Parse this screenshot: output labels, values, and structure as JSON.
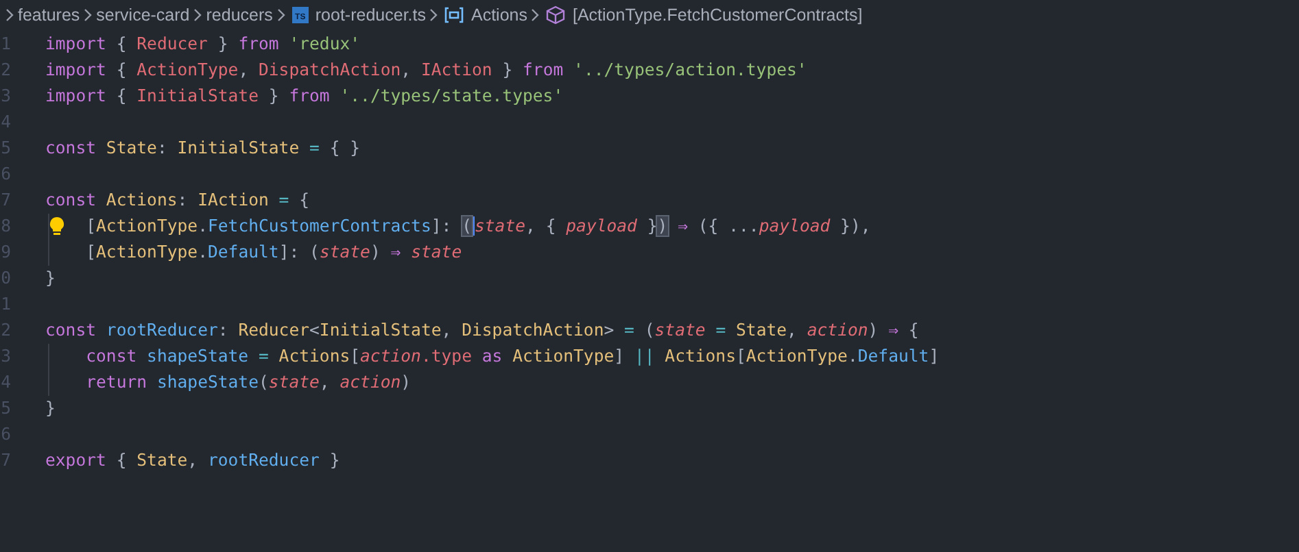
{
  "breadcrumb": [
    {
      "kind": "folder",
      "label": "features"
    },
    {
      "kind": "folder",
      "label": "service-card"
    },
    {
      "kind": "folder",
      "label": "reducers"
    },
    {
      "kind": "ts-file",
      "label": "root-reducer.ts",
      "badge": "TS"
    },
    {
      "kind": "variable",
      "label": "Actions"
    },
    {
      "kind": "member",
      "label": "[ActionType.FetchCustomerContracts]"
    }
  ],
  "lines": [
    {
      "number": "1",
      "tokens": [
        {
          "text": "import",
          "kind": "kw"
        },
        {
          "text": " { ",
          "kind": "p"
        },
        {
          "text": "Reducer",
          "kind": "var"
        },
        {
          "text": " } ",
          "kind": "p"
        },
        {
          "text": "from",
          "kind": "kw"
        },
        {
          "text": " 'redux'",
          "kind": "str"
        }
      ]
    },
    {
      "number": "2",
      "tokens": [
        {
          "text": "import",
          "kind": "kw"
        },
        {
          "text": " { ",
          "kind": "p"
        },
        {
          "text": "ActionType",
          "kind": "var"
        },
        {
          "text": ", ",
          "kind": "p"
        },
        {
          "text": "DispatchAction",
          "kind": "var"
        },
        {
          "text": ", ",
          "kind": "p"
        },
        {
          "text": "IAction",
          "kind": "var"
        },
        {
          "text": " } ",
          "kind": "p"
        },
        {
          "text": "from",
          "kind": "kw"
        },
        {
          "text": " '../types/action.types'",
          "kind": "str"
        }
      ]
    },
    {
      "number": "3",
      "tokens": [
        {
          "text": "import",
          "kind": "kw"
        },
        {
          "text": " { ",
          "kind": "p"
        },
        {
          "text": "InitialState",
          "kind": "var"
        },
        {
          "text": " } ",
          "kind": "p"
        },
        {
          "text": "from",
          "kind": "kw"
        },
        {
          "text": " '../types/state.types'",
          "kind": "str"
        }
      ]
    },
    {
      "number": "4"
    },
    {
      "number": "5",
      "tokens": [
        {
          "text": "const",
          "kind": "kw"
        },
        {
          "text": " State",
          "kind": "type"
        },
        {
          "text": ": ",
          "kind": "p"
        },
        {
          "text": "InitialState",
          "kind": "type"
        },
        {
          "text": " = ",
          "kind": "op"
        },
        {
          "text": "{ }",
          "kind": "p"
        }
      ]
    },
    {
      "number": "6"
    },
    {
      "number": "7",
      "tokens": [
        {
          "text": "const",
          "kind": "kw"
        },
        {
          "text": " Actions",
          "kind": "type"
        },
        {
          "text": ": ",
          "kind": "p"
        },
        {
          "text": "IAction",
          "kind": "type"
        },
        {
          "text": " = ",
          "kind": "op"
        },
        {
          "text": "{",
          "kind": "p"
        }
      ]
    },
    {
      "number": "8",
      "lightbulb": true,
      "tokens": [
        {
          "text": "    [",
          "kind": "p"
        },
        {
          "text": "ActionType",
          "kind": "type"
        },
        {
          "text": ".",
          "kind": "p"
        },
        {
          "text": "FetchCustomerContracts",
          "kind": "fn"
        },
        {
          "text": "]: ",
          "kind": "p"
        },
        {
          "text": "(",
          "kind": "bracket"
        },
        {
          "text": "state",
          "kind": "param",
          "cursor": true
        },
        {
          "text": ", { ",
          "kind": "p"
        },
        {
          "text": "payload",
          "kind": "param"
        },
        {
          "text": " }",
          "kind": "p"
        },
        {
          "text": ")",
          "kind": "bracket"
        },
        {
          "text": " ⇒ ",
          "kind": "kw"
        },
        {
          "text": "({ ...",
          "kind": "p"
        },
        {
          "text": "payload",
          "kind": "param"
        },
        {
          "text": " }),",
          "kind": "p"
        }
      ]
    },
    {
      "number": "9",
      "tokens": [
        {
          "text": "    [",
          "kind": "p"
        },
        {
          "text": "ActionType",
          "kind": "type"
        },
        {
          "text": ".",
          "kind": "p"
        },
        {
          "text": "Default",
          "kind": "fn"
        },
        {
          "text": "]: (",
          "kind": "p"
        },
        {
          "text": "state",
          "kind": "param"
        },
        {
          "text": ") ",
          "kind": "p"
        },
        {
          "text": "⇒",
          "kind": "kw"
        },
        {
          "text": " state",
          "kind": "param"
        }
      ]
    },
    {
      "number": "0",
      "tokens": [
        {
          "text": "}",
          "kind": "p"
        }
      ]
    },
    {
      "number": "1"
    },
    {
      "number": "2",
      "tokens": [
        {
          "text": "const",
          "kind": "kw"
        },
        {
          "text": " rootReducer",
          "kind": "fn"
        },
        {
          "text": ": ",
          "kind": "p"
        },
        {
          "text": "Reducer",
          "kind": "type"
        },
        {
          "text": "<",
          "kind": "p"
        },
        {
          "text": "InitialState",
          "kind": "type"
        },
        {
          "text": ", ",
          "kind": "p"
        },
        {
          "text": "DispatchAction",
          "kind": "type"
        },
        {
          "text": ">",
          "kind": "p"
        },
        {
          "text": " = ",
          "kind": "op"
        },
        {
          "text": "(",
          "kind": "p"
        },
        {
          "text": "state",
          "kind": "param"
        },
        {
          "text": " = ",
          "kind": "op"
        },
        {
          "text": "State",
          "kind": "type"
        },
        {
          "text": ", ",
          "kind": "p"
        },
        {
          "text": "action",
          "kind": "param"
        },
        {
          "text": ") ",
          "kind": "p"
        },
        {
          "text": "⇒",
          "kind": "kw"
        },
        {
          "text": " {",
          "kind": "p"
        }
      ]
    },
    {
      "number": "3",
      "tokens": [
        {
          "text": "    const",
          "kind": "kw"
        },
        {
          "text": " shapeState",
          "kind": "fn"
        },
        {
          "text": " = ",
          "kind": "op"
        },
        {
          "text": "Actions",
          "kind": "type"
        },
        {
          "text": "[",
          "kind": "p"
        },
        {
          "text": "action",
          "kind": "param"
        },
        {
          "text": ".type",
          "kind": "var"
        },
        {
          "text": " as",
          "kind": "kw"
        },
        {
          "text": " ActionType",
          "kind": "type"
        },
        {
          "text": "] ",
          "kind": "p"
        },
        {
          "text": "||",
          "kind": "op"
        },
        {
          "text": " Actions",
          "kind": "type"
        },
        {
          "text": "[",
          "kind": "p"
        },
        {
          "text": "ActionType",
          "kind": "type"
        },
        {
          "text": ".",
          "kind": "p"
        },
        {
          "text": "Default",
          "kind": "fn"
        },
        {
          "text": "]",
          "kind": "p"
        }
      ]
    },
    {
      "number": "4",
      "tokens": [
        {
          "text": "    return",
          "kind": "kw"
        },
        {
          "text": " shapeState",
          "kind": "fn"
        },
        {
          "text": "(",
          "kind": "p"
        },
        {
          "text": "state",
          "kind": "param"
        },
        {
          "text": ", ",
          "kind": "p"
        },
        {
          "text": "action",
          "kind": "param"
        },
        {
          "text": ")",
          "kind": "p"
        }
      ]
    },
    {
      "number": "5",
      "tokens": [
        {
          "text": "}",
          "kind": "p"
        }
      ]
    },
    {
      "number": "6"
    },
    {
      "number": "7",
      "tokens": [
        {
          "text": "export",
          "kind": "kw"
        },
        {
          "text": " { ",
          "kind": "p"
        },
        {
          "text": "State",
          "kind": "type"
        },
        {
          "text": ", ",
          "kind": "p"
        },
        {
          "text": "rootReducer",
          "kind": "fn"
        },
        {
          "text": " }",
          "kind": "p"
        }
      ]
    }
  ]
}
